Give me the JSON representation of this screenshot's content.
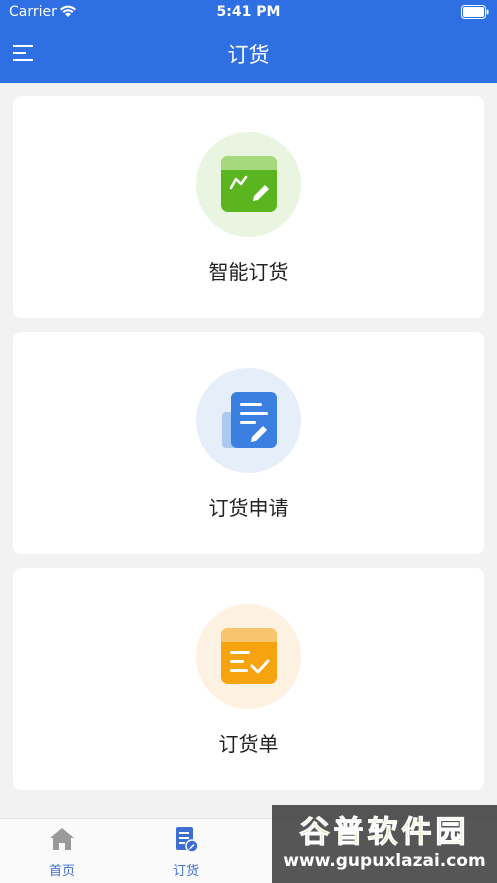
{
  "status_bar": {
    "carrier": "Carrier",
    "time": "5:41 PM"
  },
  "header": {
    "title": "订货",
    "color": "#2e6fe4"
  },
  "cards": [
    {
      "label": "智能订货",
      "icon": "smart-order-icon",
      "color": "#5bb51e",
      "bg": "#e9f5e0"
    },
    {
      "label": "订货申请",
      "icon": "order-request-icon",
      "color": "#3b80e0",
      "bg": "#e6eefa"
    },
    {
      "label": "订货单",
      "icon": "order-list-icon",
      "color": "#f6a310",
      "bg": "#fdf1e1"
    }
  ],
  "tabbar": {
    "items": [
      {
        "label": "首页",
        "icon": "home-icon"
      },
      {
        "label": "订货",
        "icon": "order-doc-icon"
      }
    ]
  },
  "watermark": {
    "title": "谷普软件园",
    "url": "www.gupuxlazai.com"
  }
}
